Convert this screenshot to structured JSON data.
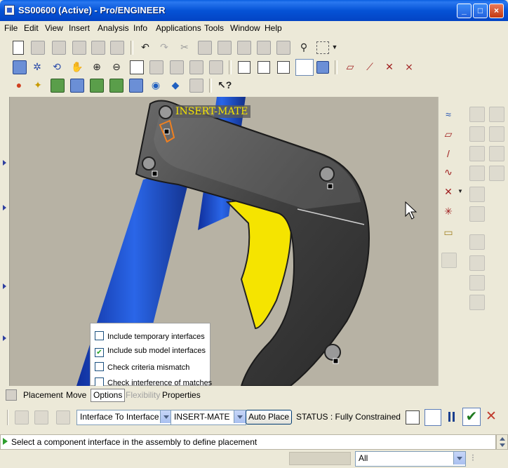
{
  "window": {
    "title": "SS00600 (Active) - Pro/ENGINEER",
    "controls": [
      "_",
      "□",
      "×"
    ]
  },
  "menu": [
    "File",
    "Edit",
    "View",
    "Insert",
    "Analysis",
    "Info",
    "Applications",
    "Tools",
    "Window",
    "Help"
  ],
  "viewport": {
    "annotation": "INSERT-MATE"
  },
  "options_panel": {
    "items": [
      {
        "label": "Include temporary interfaces",
        "checked": false
      },
      {
        "label": "Include sub model interfaces",
        "checked": true
      },
      {
        "label": "Check criteria mismatch",
        "checked": false
      },
      {
        "label": "Check interference of matches",
        "checked": false
      }
    ]
  },
  "dashboard": {
    "tabs": [
      "Placement",
      "Move",
      "Options",
      "Flexibility",
      "Properties"
    ],
    "constraint_type": "Interface To Interface",
    "interface": "INSERT-MATE",
    "auto_place": "Auto Place",
    "status": "STATUS : Fully Constrained"
  },
  "message": "Select a component interface in the assembly to define placement",
  "statusbar": {
    "filter": "All"
  },
  "colors": {
    "accept": "#1f7a1f",
    "cancel": "#c0392b",
    "highlight": "#f5e400",
    "body": "#4a4a4a",
    "tube": "#1e4fc8"
  }
}
